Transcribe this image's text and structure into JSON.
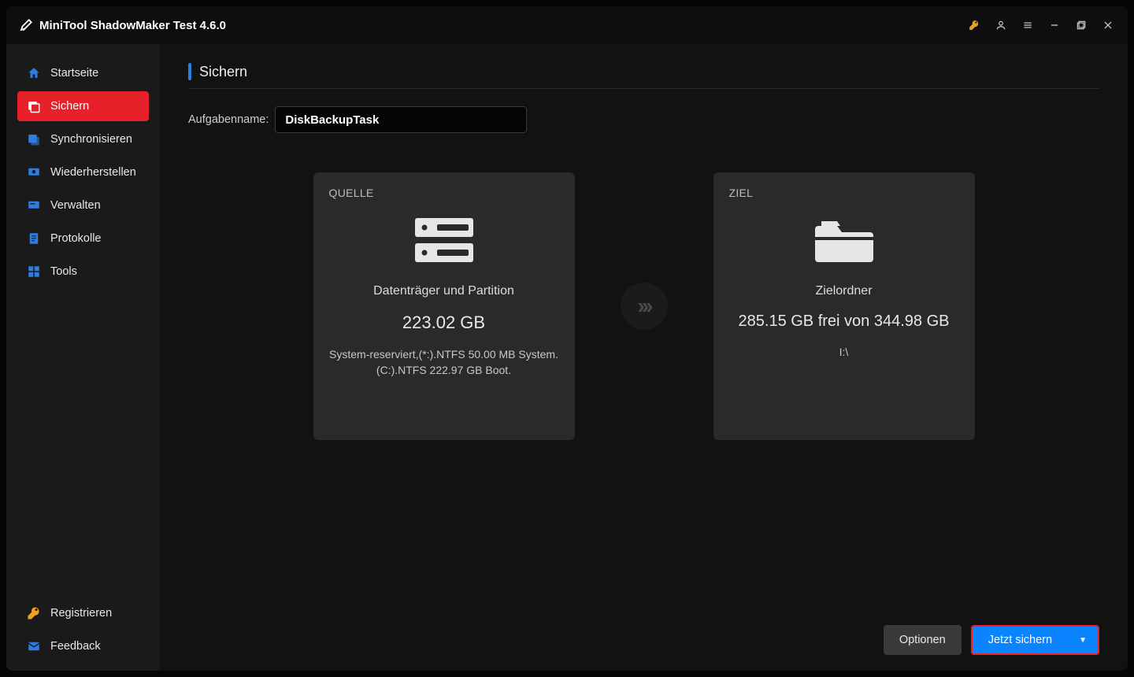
{
  "titlebar": {
    "title": "MiniTool ShadowMaker Test 4.6.0"
  },
  "sidebar": {
    "items": [
      {
        "label": "Startseite"
      },
      {
        "label": "Sichern"
      },
      {
        "label": "Synchronisieren"
      },
      {
        "label": "Wiederherstellen"
      },
      {
        "label": "Verwalten"
      },
      {
        "label": "Protokolle"
      },
      {
        "label": "Tools"
      }
    ],
    "register": "Registrieren",
    "feedback": "Feedback"
  },
  "page": {
    "title": "Sichern",
    "taskname_label": "Aufgabenname:",
    "taskname_value": "DiskBackupTask"
  },
  "source": {
    "label": "QUELLE",
    "heading": "Datenträger und Partition",
    "size": "223.02 GB",
    "detail": "System-reserviert,(*:).NTFS 50.00 MB System.(C:).NTFS 222.97 GB Boot."
  },
  "dest": {
    "label": "ZIEL",
    "heading": "Zielordner",
    "free": "285.15 GB frei von 344.98 GB",
    "path": "I:\\"
  },
  "footer": {
    "options": "Optionen",
    "run": "Jetzt sichern"
  }
}
